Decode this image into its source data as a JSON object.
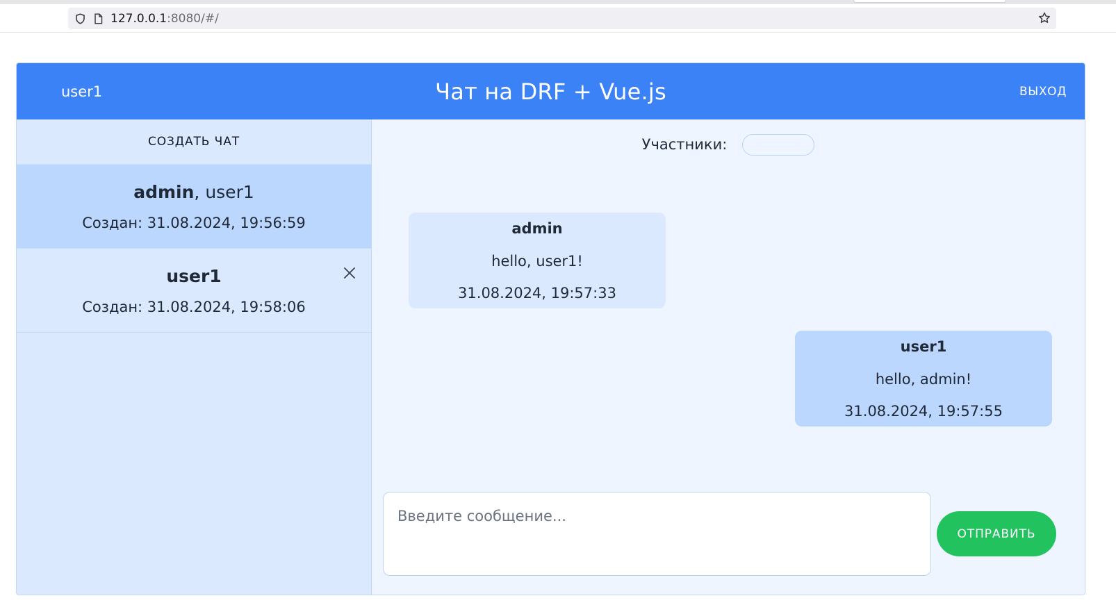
{
  "browser": {
    "url_host": "127.0.0.1",
    "url_rest": ":8080/#/",
    "icons": [
      "shield-icon",
      "page-icon",
      "star-icon"
    ]
  },
  "header": {
    "user": "user1",
    "title": "Чат на DRF + Vue.js",
    "logout_label": "ВЫХОД"
  },
  "sidebar": {
    "create_label": "СОЗДАТЬ ЧАТ",
    "chats": [
      {
        "name_bold": "admin",
        "name_rest": ", user1",
        "created": "Создан: 31.08.2024, 19:56:59",
        "active": true
      },
      {
        "name_bold": "user1",
        "name_rest": "",
        "created": "Создан: 31.08.2024, 19:58:06",
        "active": false,
        "delete_icon": "close-icon"
      }
    ]
  },
  "chat": {
    "participants_label": "Участники:",
    "messages": [
      {
        "author": "admin",
        "text": "hello, user1!",
        "time": "31.08.2024, 19:57:33",
        "direction": "incoming"
      },
      {
        "author": "user1",
        "text": "hello, admin!",
        "time": "31.08.2024, 19:57:55",
        "direction": "outgoing"
      }
    ],
    "composer_placeholder": "Введите сообщение...",
    "composer_value": "",
    "send_label": "ОТПРАВИТЬ"
  },
  "colors": {
    "header_bg": "#3b82f6",
    "sidebar_bg": "#dbe9fe",
    "active_chat_bg": "#bcd7fd",
    "main_bg": "#eef5ff",
    "send_button_bg": "#22c35e"
  }
}
